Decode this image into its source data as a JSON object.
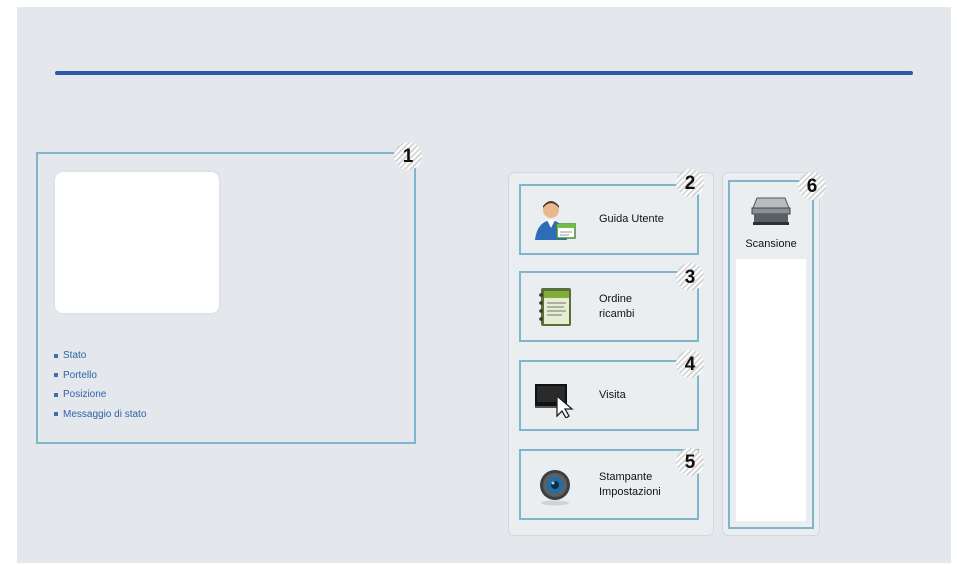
{
  "status_panel": {
    "callout": "1",
    "links": [
      "Stato",
      "Portello",
      "Posizione",
      "Messaggio di stato"
    ]
  },
  "menu": [
    {
      "callout": "2",
      "label": "Guida Utente",
      "icon": "user-guide-icon"
    },
    {
      "callout": "3",
      "label": "Ordine\nricambi",
      "icon": "order-supplies-icon"
    },
    {
      "callout": "4",
      "label": "Visita",
      "icon": "visit-cursor-icon"
    },
    {
      "callout": "5",
      "label": "Stampante\nImpostazioni",
      "icon": "printer-settings-icon"
    }
  ],
  "scan": {
    "callout": "6",
    "label": "Scansione",
    "icon": "scanner-icon"
  },
  "colors": {
    "accent_rule": "#2d5aa6",
    "panel_border": "#7fb6cc",
    "link": "#2f63a8",
    "background": "#e4e8ec"
  }
}
